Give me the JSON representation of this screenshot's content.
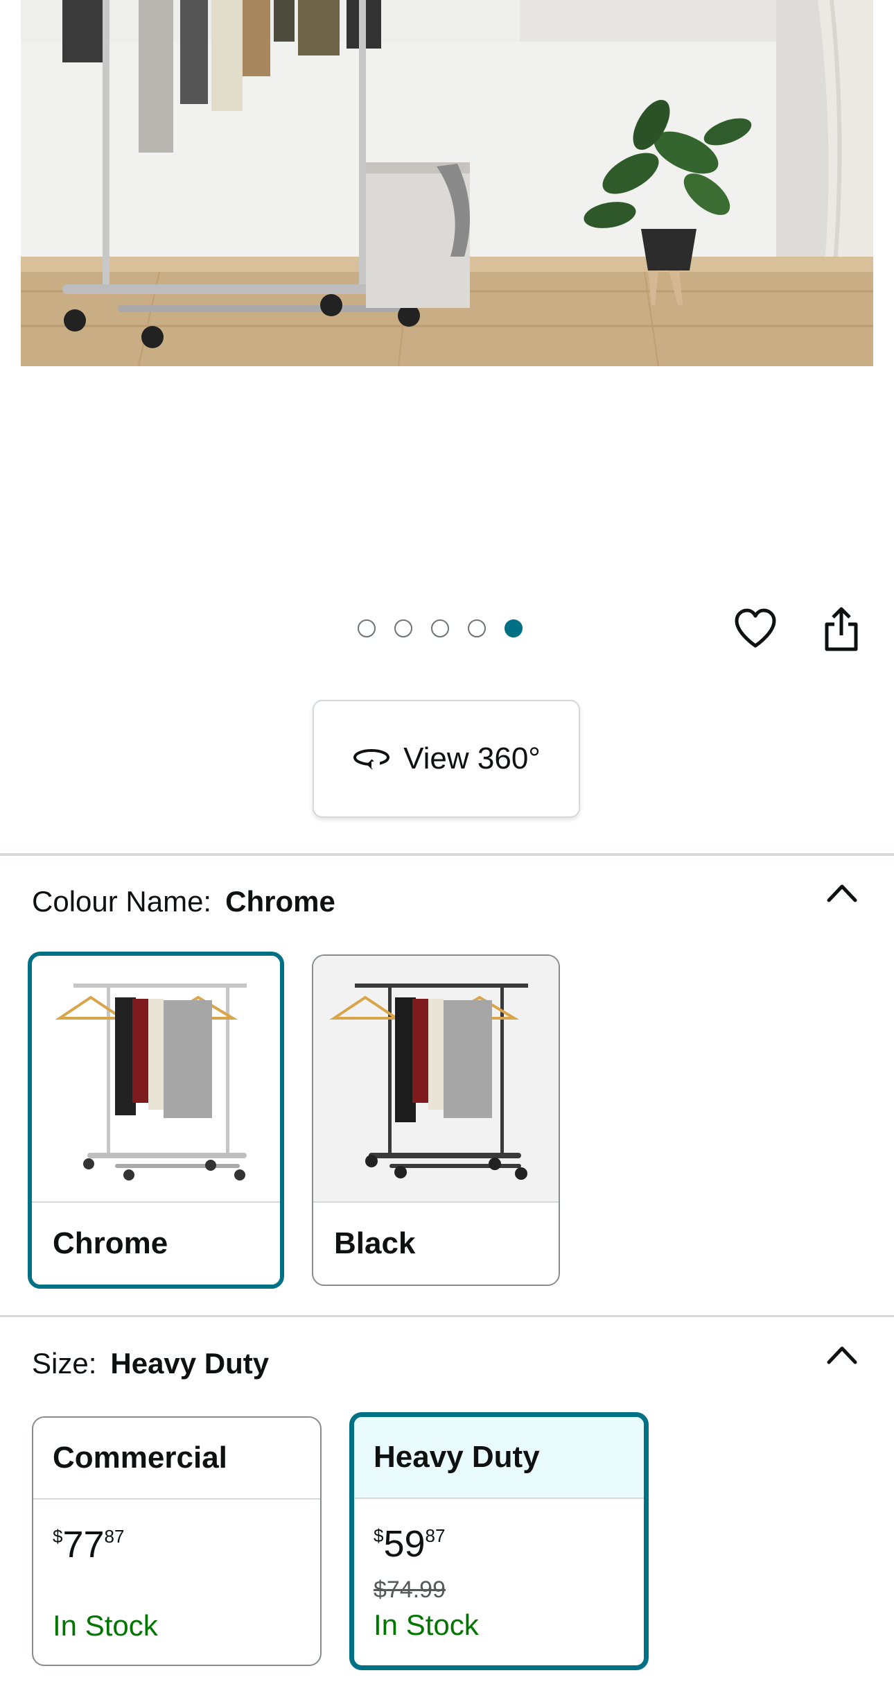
{
  "carousel": {
    "count": 5,
    "active_index": 4
  },
  "actions": {
    "wishlist_icon": "heart-outline-icon",
    "share_icon": "share-icon"
  },
  "view360": {
    "label": "View 360°",
    "icon": "rotate-360-icon"
  },
  "colour": {
    "label": "Colour Name:",
    "selected": "Chrome",
    "options": [
      {
        "name": "Chrome"
      },
      {
        "name": "Black"
      }
    ]
  },
  "size": {
    "label": "Size:",
    "selected": "Heavy Duty",
    "options": [
      {
        "name": "Commercial",
        "currency": "$",
        "whole": "77",
        "fraction": "87",
        "status": "In Stock"
      },
      {
        "name": "Heavy Duty",
        "currency": "$",
        "whole": "59",
        "fraction": "87",
        "was_price": "$74.99",
        "status": "In Stock"
      }
    ]
  },
  "colors": {
    "accent": "#007185",
    "selected_bg": "#eafbfd",
    "in_stock": "#007600",
    "border": "#d5d9d9"
  }
}
